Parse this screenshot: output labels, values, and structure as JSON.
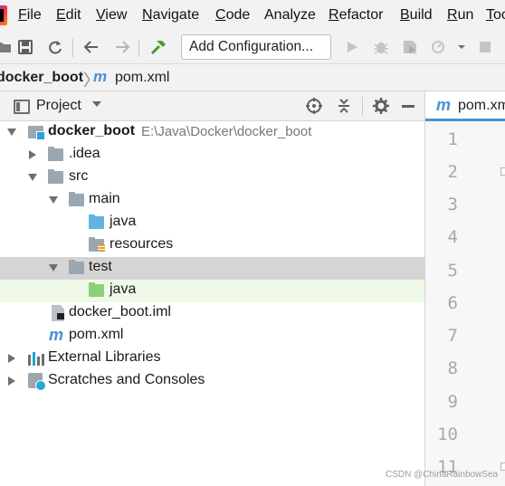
{
  "menu": {
    "items": [
      {
        "first": "F",
        "rest": "ile"
      },
      {
        "first": "E",
        "rest": "dit"
      },
      {
        "first": "V",
        "rest": "iew"
      },
      {
        "first": "N",
        "rest": "avigate"
      },
      {
        "first": "C",
        "rest": "ode"
      },
      {
        "first": "",
        "rest": "Analyze"
      },
      {
        "first": "R",
        "rest": "efactor"
      },
      {
        "first": "B",
        "rest": "uild"
      },
      {
        "first": "R",
        "rest": "un"
      },
      {
        "first": "T",
        "rest": "oo"
      }
    ]
  },
  "toolbar": {
    "add_config_label": "Add Configuration..."
  },
  "breadcrumb": {
    "project": "docker_boot",
    "separator": "〉",
    "file_icon": "m",
    "file": "pom.xml"
  },
  "project_panel": {
    "title": "Project"
  },
  "tree": {
    "root_name": "docker_boot",
    "root_path": "E:\\Java\\Docker\\docker_boot",
    "idea": ".idea",
    "src": "src",
    "main": "main",
    "main_java": "java",
    "resources": "resources",
    "test": "test",
    "test_java": "java",
    "iml": "docker_boot.iml",
    "pom": "pom.xml",
    "ext_libs": "External Libraries",
    "scratches": "Scratches and Consoles",
    "pom_icon": "m"
  },
  "editor": {
    "tab_icon": "m",
    "tab_label": "pom.xm",
    "line_numbers": [
      "1",
      "2",
      "3",
      "4",
      "5",
      "6",
      "7",
      "8",
      "9",
      "10",
      "11"
    ]
  },
  "watermark": "CSDN @ChinaRainbowSea",
  "colors": {
    "selected_row": "#d5d5d5",
    "highlight_row": "#eef9e7",
    "maven_blue": "#4a90d9",
    "tab_underline": "#4a8fd9"
  }
}
